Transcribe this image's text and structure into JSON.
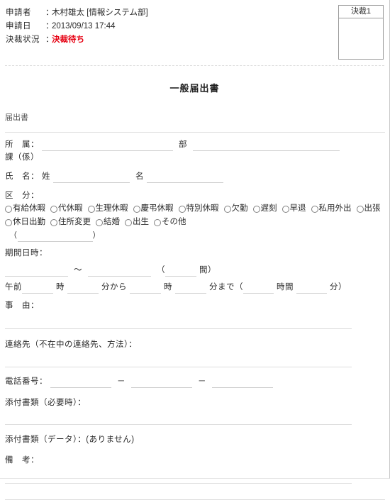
{
  "header": {
    "rows": [
      {
        "label": "申請者",
        "colon": "：",
        "value": "木村雄太 [情報システム部]",
        "status": false
      },
      {
        "label": "申請日",
        "colon": "：",
        "value": "2013/09/13 17:44",
        "status": false
      },
      {
        "label": "決裁状況",
        "colon": "：",
        "value": "決裁待ち",
        "status": true
      }
    ],
    "status_color": "#e60012",
    "approval_box": {
      "title": "決裁1"
    }
  },
  "document": {
    "title": "一般届出書",
    "kind_label": "届出書"
  },
  "fields": {
    "affiliation": {
      "label": "所　属：",
      "unit_label": "部",
      "sub_label": "課（係）"
    },
    "name": {
      "label": "氏　名：",
      "last_label": "姓",
      "first_label": "名"
    },
    "category": {
      "label": "区　分：",
      "options": [
        "有給休暇",
        "代休暇",
        "生理休暇",
        "慶弔休暇",
        "特別休暇",
        "欠勤",
        "遅刻",
        "早退",
        "私用外出",
        "出張",
        "休日出勤",
        "住所変更",
        "結婚",
        "出生",
        "その他"
      ],
      "other_open_paren": "（",
      "other_close_paren": "）"
    },
    "period": {
      "label": "期間日時：",
      "range_separator": "～",
      "total_open_paren": "（",
      "total_unit": "間",
      "total_close_paren": "）",
      "am_label": "午前",
      "hour_label": "時",
      "minute_from_label": "分から",
      "hour2_label": "時",
      "minute_to_label": "分まで",
      "duration_open_paren": "（",
      "duration_hour_label": "時間",
      "duration_minute_label": "分",
      "duration_close_paren": "）"
    },
    "reason": {
      "label": "事　由："
    },
    "contact": {
      "label": "連絡先（不在中の連絡先、方法）："
    },
    "phone": {
      "label": "電話番号：",
      "separator": "－"
    },
    "attachment": {
      "label": "添付書類（必要時）："
    },
    "attachment_data": {
      "label": "添付書類（データ）：",
      "value": "(ありません)"
    },
    "remarks": {
      "label": "備　考："
    }
  }
}
